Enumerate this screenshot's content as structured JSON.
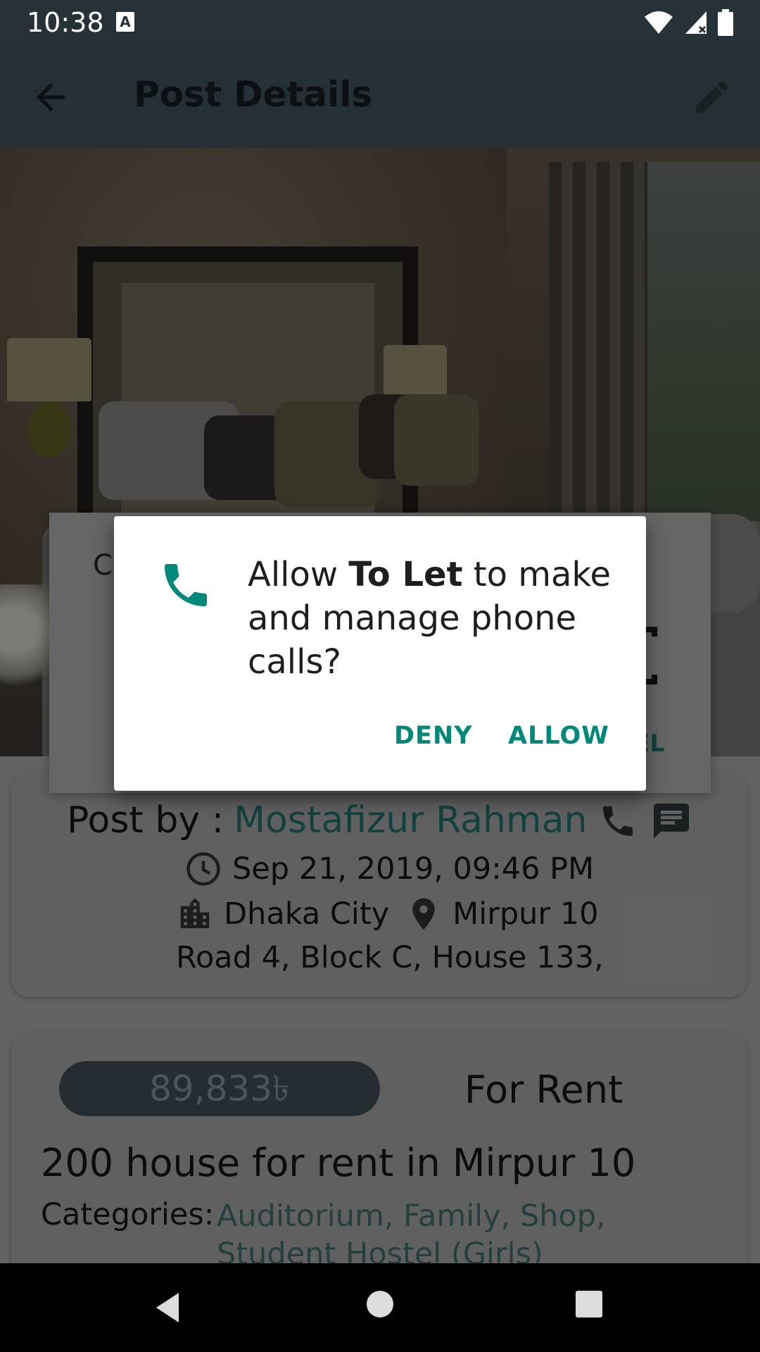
{
  "status_bar": {
    "time": "10:38",
    "keyboard_indicator": "A"
  },
  "app_bar": {
    "title": "Post Details"
  },
  "post": {
    "post_by_label": "Post by :",
    "author": "Mostafizur Rahman",
    "date": "Sep 21, 2019, 09:46 PM",
    "city": "Dhaka City",
    "area": "Mirpur 10",
    "address": "Road 4, Block C, House 133,"
  },
  "listing": {
    "price": "89,833৳",
    "type": "For Rent",
    "title": "200 house for rent in Mirpur 10",
    "categories_label": "Categories:",
    "categories": "Auditorium, Family, Shop, Student Hostel (Girls)"
  },
  "underlying_dialog": {
    "partial_letter": "C",
    "partial_button": "EL"
  },
  "permission_dialog": {
    "text_before": "Allow ",
    "app_name": "To Let",
    "text_after": " to make and manage phone calls?",
    "deny_label": "DENY",
    "allow_label": "ALLOW"
  },
  "colors": {
    "accent": "#00897b",
    "author_link": "#1f6a66",
    "app_bar": "#3b4d57",
    "status_bar": "#263238"
  },
  "icons": {
    "permission": "phone-icon",
    "back": "arrow-back-icon",
    "edit": "pencil-icon"
  }
}
